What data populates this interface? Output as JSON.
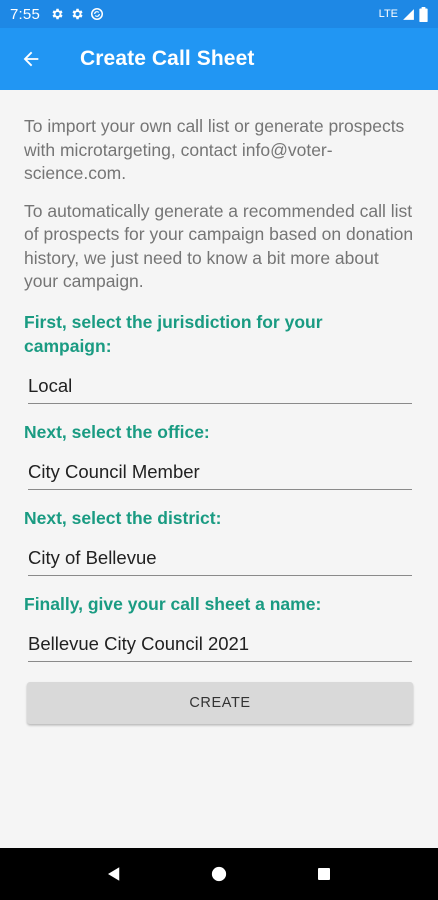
{
  "status_bar": {
    "time": "7:55",
    "network": "LTE",
    "icons": [
      "gear-icon",
      "gear-icon",
      "sync-icon",
      "signal-icon",
      "battery-icon"
    ]
  },
  "app_bar": {
    "title": "Create Call Sheet",
    "back_icon": "arrow-left-icon"
  },
  "intro": {
    "para1": "To import your own call list or generate prospects with microtargeting, contact info@voter-science.com.",
    "para2": "To automatically generate a recommended call list of prospects for your campaign based on donation history, we just need to know a bit more about your campaign."
  },
  "form": {
    "jurisdiction": {
      "label": "First, select the jurisdiction for your campaign:",
      "value": "Local"
    },
    "office": {
      "label": "Next, select the office:",
      "value": "City Council Member"
    },
    "district": {
      "label": "Next, select the district:",
      "value": "City of Bellevue"
    },
    "name": {
      "label": "Finally, give your call sheet a name:",
      "value": "Bellevue City Council 2021"
    },
    "create_label": "CREATE"
  },
  "nav_bar": {
    "icons": [
      "back-triangle-icon",
      "home-circle-icon",
      "recents-square-icon"
    ]
  },
  "colors": {
    "status_bar": "#1e88e5",
    "app_bar": "#2196f3",
    "accent_label": "#1a9b82",
    "button": "#d9d9d9"
  }
}
